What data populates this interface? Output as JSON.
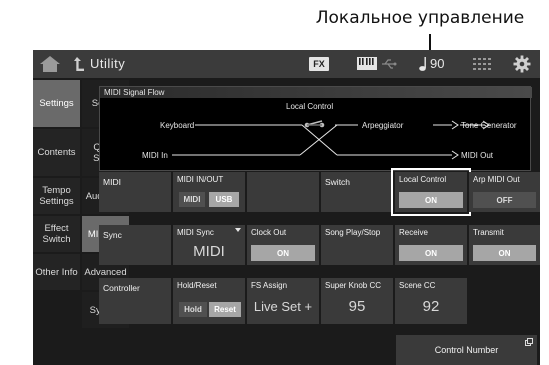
{
  "callout": {
    "label": "Локальное управление"
  },
  "header": {
    "title": "Utility",
    "fx_label": "FX",
    "tempo": "90",
    "icons": [
      "home-icon",
      "back-arrow-icon",
      "keyboard-icon",
      "usb-icon",
      "note-icon",
      "grid-icon",
      "gear-icon"
    ]
  },
  "tabs": {
    "left": [
      {
        "label": "Settings",
        "active": true
      },
      {
        "label": "Contents"
      },
      {
        "label": "Tempo Settings"
      },
      {
        "label": "Effect Switch"
      },
      {
        "label": "Other Info"
      }
    ],
    "right": [
      {
        "label": "Sound"
      },
      {
        "label": "Quick Setup"
      },
      {
        "label": "Audio I/O"
      },
      {
        "label": "MIDI I/O",
        "active": true
      },
      {
        "label": "Advanced"
      },
      {
        "label": "System"
      }
    ]
  },
  "flow": {
    "title": "MIDI Signal Flow",
    "local_control": "Local Control",
    "keyboard": "Keyboard",
    "arpeggiator": "Arpeggiator",
    "tone_generator": "Tone Generator",
    "midi_in": "MIDI In",
    "midi_out": "MIDI Out"
  },
  "rows": {
    "midi": {
      "label": "MIDI",
      "midi_io": {
        "head": "MIDI IN/OUT",
        "options": [
          "MIDI",
          "USB"
        ],
        "selected": "USB"
      },
      "switch_label": "Switch",
      "local_control": {
        "head": "Local Control",
        "value": "ON"
      },
      "arp_midi_out": {
        "head": "Arp MIDI Out",
        "value": "OFF"
      }
    },
    "sync": {
      "label": "Sync",
      "midi_sync": {
        "head": "MIDI Sync",
        "value": "MIDI"
      },
      "clock_out": {
        "head": "Clock Out",
        "value": "ON"
      },
      "song_play_stop": {
        "head": "Song Play/Stop"
      },
      "receive": {
        "head": "Receive",
        "value": "ON"
      },
      "transmit": {
        "head": "Transmit",
        "value": "ON"
      }
    },
    "controller": {
      "label": "Controller",
      "hold_reset": {
        "head": "Hold/Reset",
        "options": [
          "Hold",
          "Reset"
        ],
        "selected": "Reset"
      },
      "fs_assign": {
        "head": "FS Assign",
        "value": "Live Set +"
      },
      "super_knob_cc": {
        "head": "Super Knob CC",
        "value": "95"
      },
      "scene_cc": {
        "head": "Scene CC",
        "value": "92"
      }
    }
  },
  "control_number": {
    "label": "Control Number"
  },
  "colors": {
    "background": "#1b1b1b",
    "cell": "#3a3a3a",
    "active_tab": "#6a6a6a",
    "button_on": "#a6a6a6",
    "highlight": "#ffffff"
  }
}
